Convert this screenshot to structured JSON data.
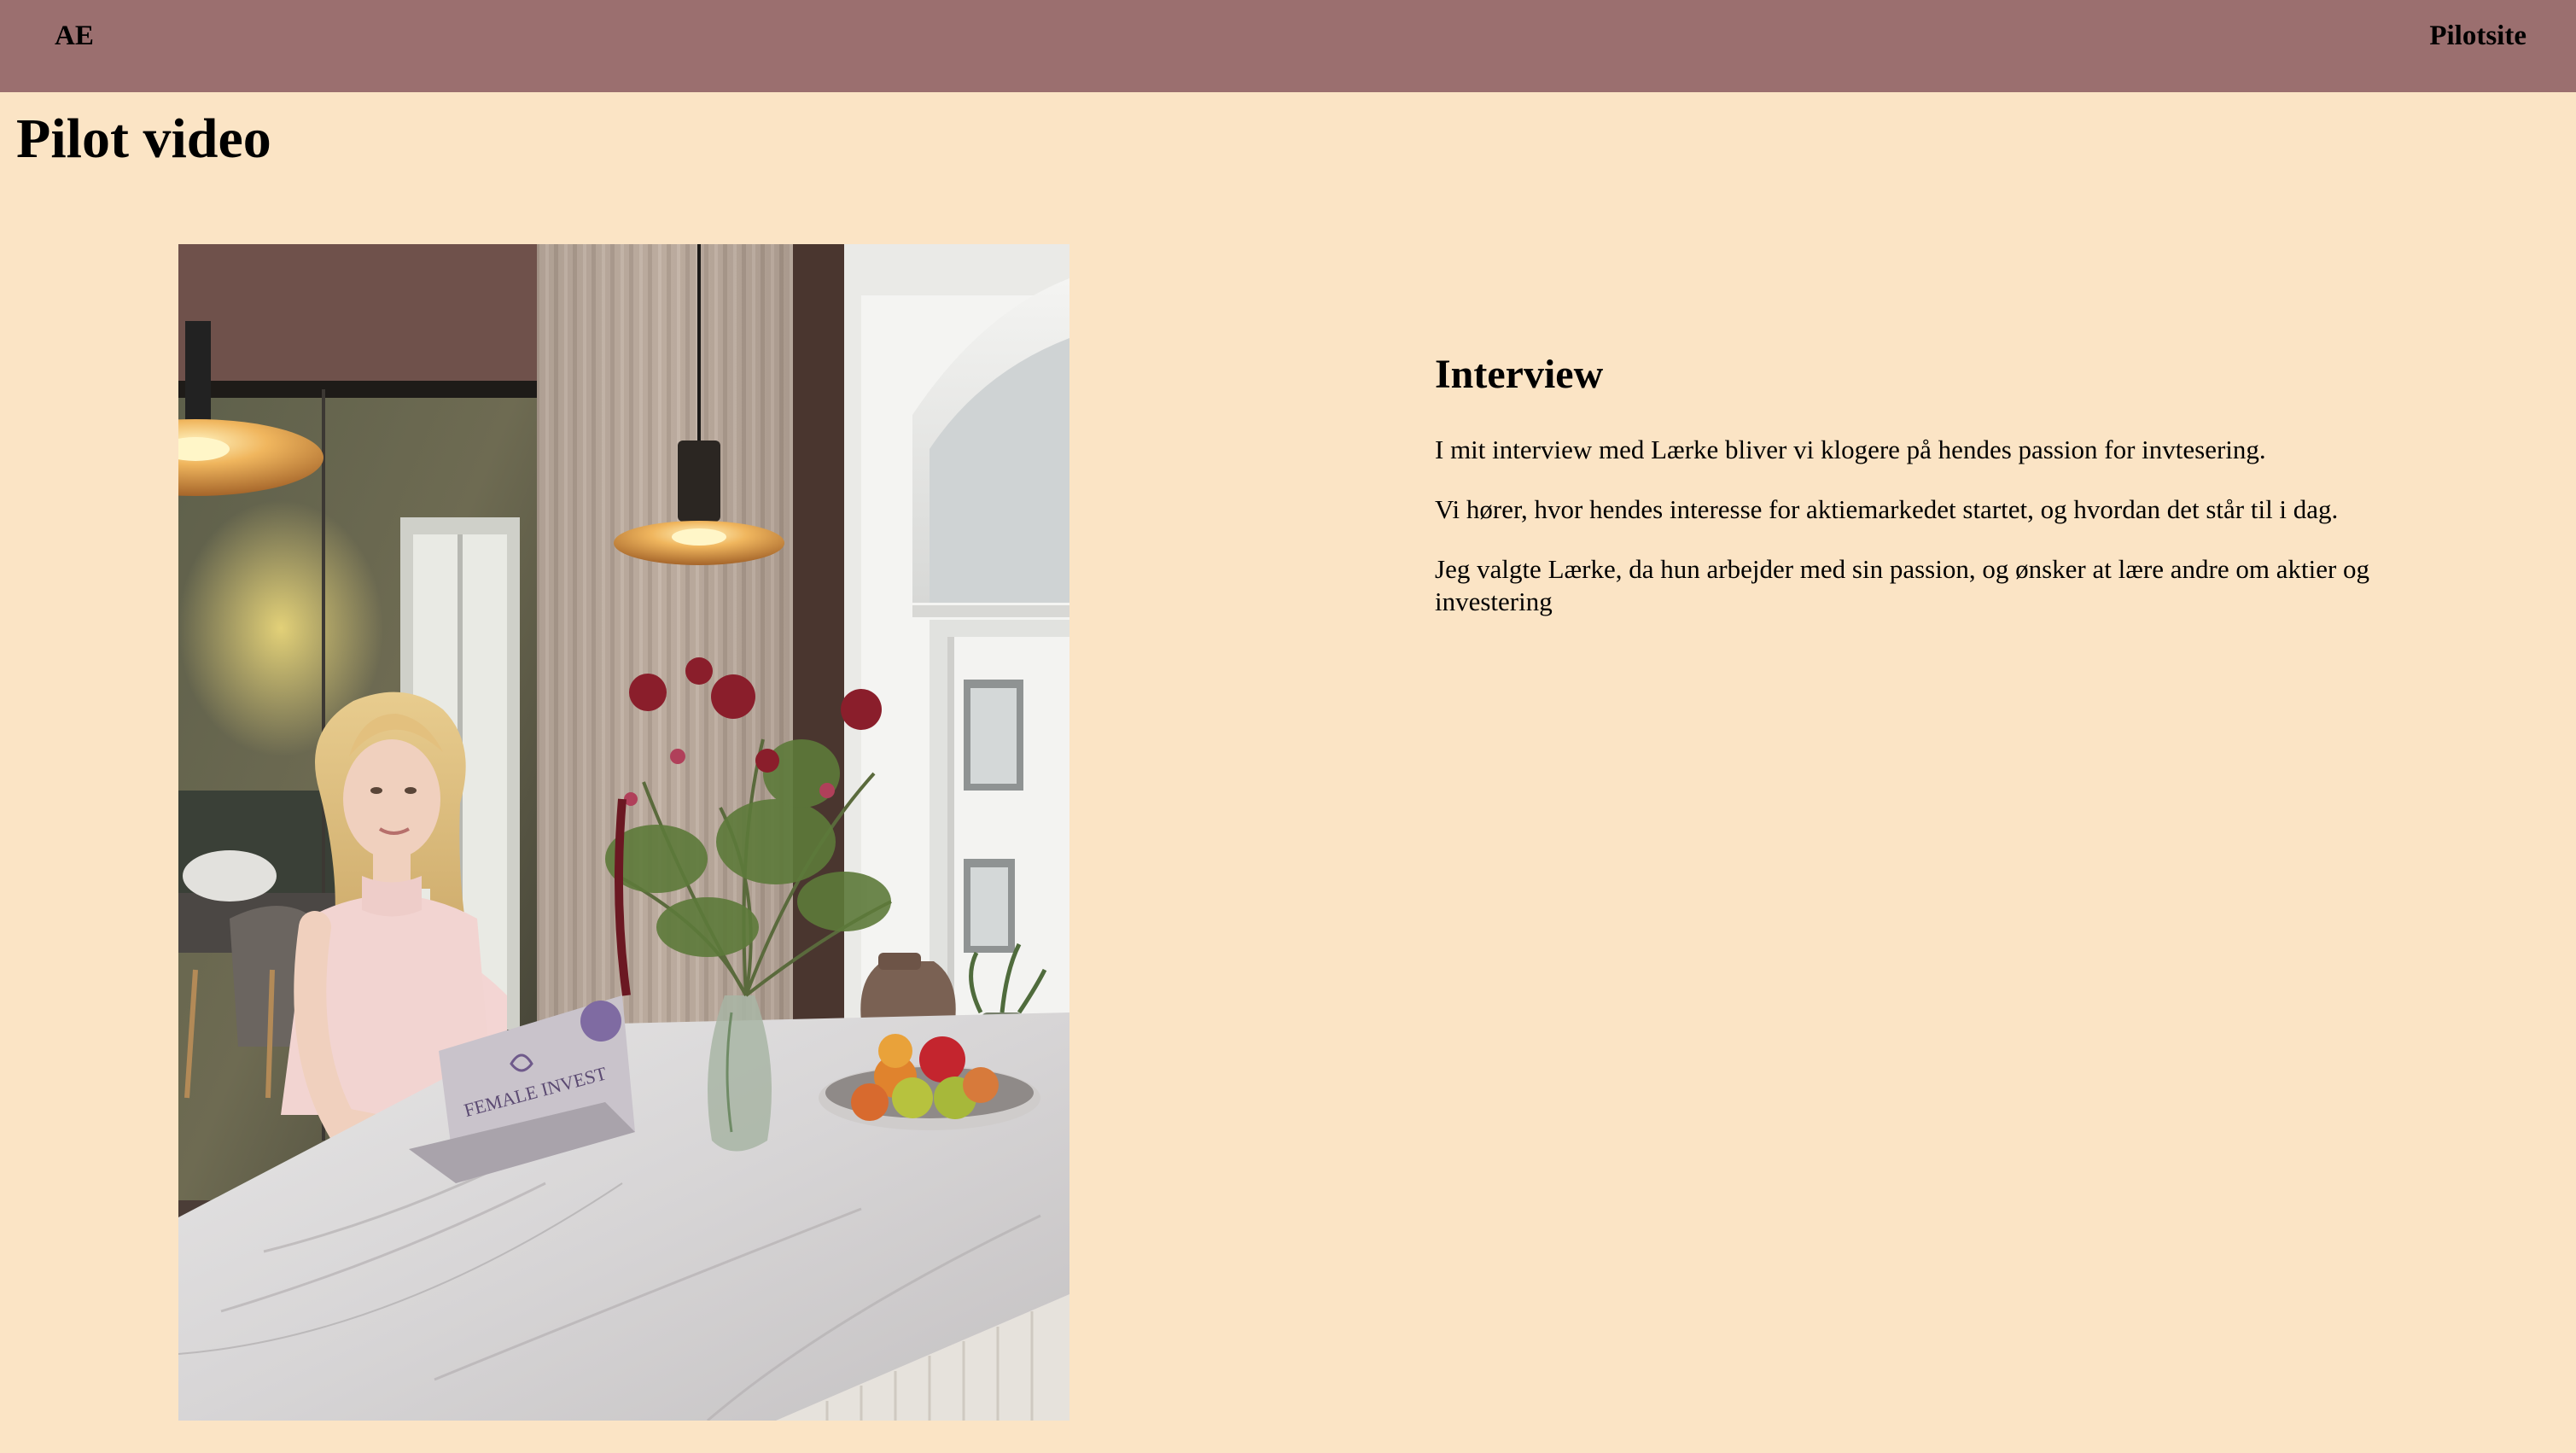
{
  "header": {
    "brand": "AE",
    "nav_link": "Pilotsite",
    "background_color": "#9B6F6F"
  },
  "page": {
    "title": "Pilot video",
    "background_color": "#FBE4C5"
  },
  "photo": {
    "subject": "woman-at-kitchen-table-with-laptop-flowers-and-fruit-bowl",
    "laptop_sticker_text": "FEMALE INVEST"
  },
  "interview": {
    "heading": "Interview",
    "paragraphs": [
      "I mit interview med Lærke bliver vi klogere på hendes passion for invtesering.",
      "Vi hører, hvor hendes interesse for aktiemarkedet startet, og hvordan det står til i dag.",
      "Jeg valgte Lærke, da hun arbejder med sin passion, og ønsker at lære andre om aktier og investering"
    ]
  }
}
